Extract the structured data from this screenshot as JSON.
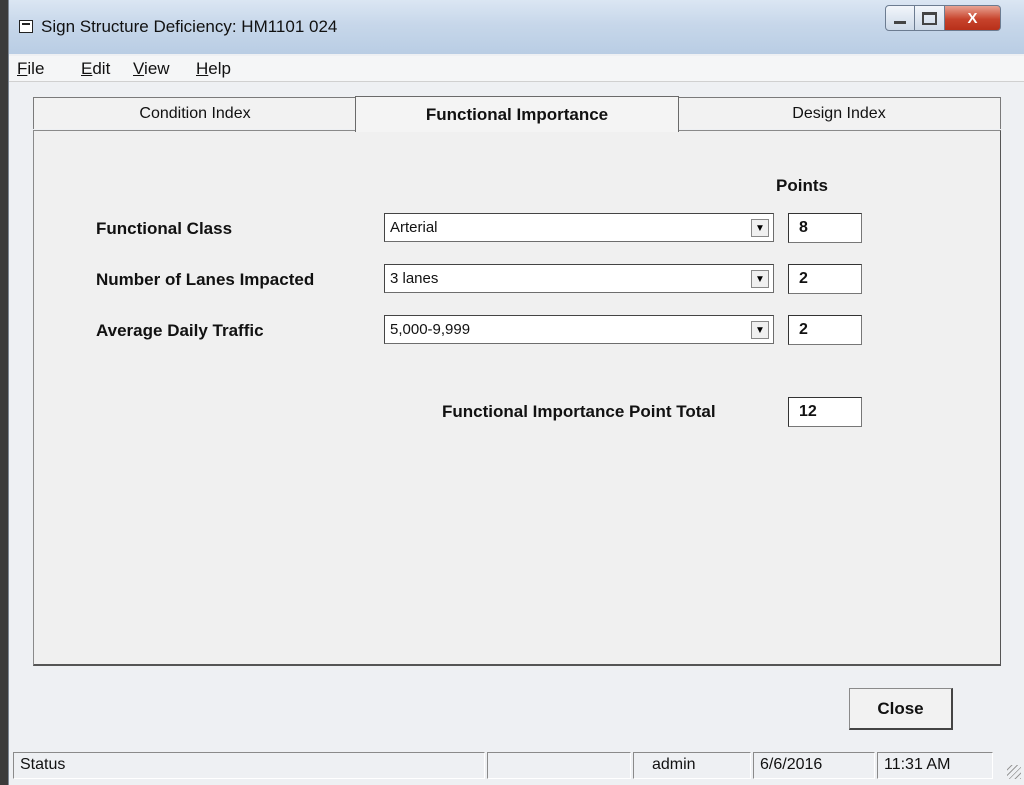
{
  "window": {
    "title": "Sign Structure Deficiency: HM1101 024",
    "controls": {
      "close_glyph": "X"
    }
  },
  "menu": [
    {
      "accel": "F",
      "rest": "ile"
    },
    {
      "accel": "E",
      "rest": "dit"
    },
    {
      "accel": "V",
      "rest": "iew"
    },
    {
      "accel": "H",
      "rest": "elp"
    }
  ],
  "tabs": [
    "Condition Index",
    "Functional Importance",
    "Design Index"
  ],
  "active_tab": "Functional Importance",
  "form": {
    "points_header": "Points",
    "rows": [
      {
        "label": "Functional Class",
        "value": "Arterial",
        "points": "8"
      },
      {
        "label": "Number of Lanes Impacted",
        "value": "3 lanes",
        "points": "2"
      },
      {
        "label": "Average Daily Traffic",
        "value": "5,000-9,999",
        "points": "2"
      }
    ],
    "total_label": "Functional Importance Point Total",
    "total_value": "12"
  },
  "close_button": "Close",
  "status": {
    "label": "Status",
    "user": "admin",
    "date": "6/6/2016",
    "time": "11:31 AM"
  }
}
